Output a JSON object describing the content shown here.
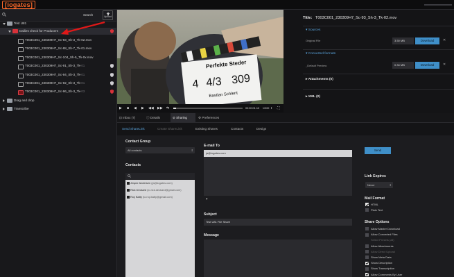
{
  "app": {
    "logo": "iogates"
  },
  "search": {
    "button_label": "Search",
    "upload_label": "Upload"
  },
  "tree": [
    {
      "label": "Test U81",
      "type": "folder",
      "suffix": ""
    },
    {
      "label": "Dailies check for Producers",
      "type": "folder-red",
      "suffix": ""
    },
    {
      "label": "T003C001_230309H7_Sc-93_Sh-3_Tk-02.mov",
      "type": "video",
      "suffix": ""
    },
    {
      "label": "T003C001_230309H7_Sc-88_Sh-7_Tk-01.mov",
      "type": "video",
      "suffix": ""
    },
    {
      "label": "T003C001_230309H7_Sc-104_Sh-5_Tk-0x.mov",
      "type": "video",
      "suffix": ""
    },
    {
      "label": "T003C001_230309H7_Sc-91_Sh-3_Tk-",
      "type": "video",
      "suffix": "01"
    },
    {
      "label": "T003C001_230309H7_Sc-94_Sh-3_Tk-",
      "type": "video",
      "suffix": "01"
    },
    {
      "label": "T003C001_230309H7_Sc-92_Sh-3_Tk-",
      "type": "video",
      "suffix": "01"
    },
    {
      "label": "T003C001_230309H7_Sc-96_Sh-3_Tk-",
      "type": "video-red",
      "suffix": "03"
    },
    {
      "label": "Drag and drop",
      "type": "folder",
      "suffix": ""
    },
    {
      "label": "Transcribe",
      "type": "folder",
      "suffix": ""
    }
  ],
  "player": {
    "time": "00:00:01:13",
    "duration": "1/200",
    "progress": 0.04,
    "clapper": {
      "title": "Perfekte Steder",
      "roll": "4",
      "scene": "4/3",
      "take": "309",
      "director": "Bastian Schlent"
    }
  },
  "info": {
    "title_label": "Title:",
    "title_value": "T003C001_230309H7_Sc-93_Sh-3_Tk-02.mov",
    "sources_label": "Sources",
    "original_label": "Original File",
    "original_size": "3.50 MB",
    "converted_label": "Converted formats",
    "preview_label": "_Default Preview",
    "preview_size": "0.34 MB",
    "download_label": "Download",
    "attachments_label": "Attachments (0)",
    "xml_label": "XML (0)"
  },
  "tabs": [
    {
      "label": "Inbox (7)",
      "icon": "inbox-icon"
    },
    {
      "label": "Details",
      "icon": "info-icon"
    },
    {
      "label": "Sharing",
      "icon": "link-icon"
    },
    {
      "label": "Preferences",
      "icon": "gear-icon"
    }
  ],
  "subtabs": [
    "Send ShareLink",
    "Create ShareLink",
    "Existing Shares",
    "Contacts",
    "Design"
  ],
  "sharing": {
    "contact_group_label": "Contact Group",
    "contact_group_value": "All contacts",
    "contacts_label": "Contacts",
    "contacts": [
      {
        "name": "Jesper Andersen",
        "email": "(ja@iogates.com)"
      },
      {
        "name": "Rick Deckard",
        "email": "(io.rick.deckard@gmail.com)"
      },
      {
        "name": "Roy Batty",
        "email": "(io.roy.batty@gmail.com)"
      }
    ],
    "email_to_label": "E-mail To",
    "email_to_value": "ja@iogates.com",
    "subject_label": "Subject",
    "subject_value": "Test U81 File Share",
    "message_label": "Message",
    "send_label": "Send",
    "link_expires_label": "Link Expires",
    "link_expires_value": "Never",
    "mail_format_label": "Mail Format",
    "mail_formats": [
      {
        "label": "HTML",
        "checked": true
      },
      {
        "label": "Plain Text",
        "checked": false
      }
    ],
    "share_options_label": "Share Options",
    "share_options": [
      {
        "label": "Allow Master Download",
        "checked": false,
        "dim": false
      },
      {
        "label": "Allow Converted Files",
        "checked": false,
        "dim": false
      },
      {
        "label": "Select Presets (all)",
        "checked": null,
        "dim": true
      },
      {
        "label": "Allow Attachments",
        "checked": false,
        "dim": false
      },
      {
        "label": "Allow Direct Upload",
        "checked": false,
        "dim": true
      },
      {
        "label": "Show Meta Data",
        "checked": false,
        "dim": false
      },
      {
        "label": "Show Description",
        "checked": true,
        "dim": false
      },
      {
        "label": "Show Transcription",
        "checked": false,
        "dim": false
      },
      {
        "label": "Allow Comments By User",
        "checked": true,
        "dim": false
      }
    ]
  },
  "colors": {
    "accent": "#3f8fc8",
    "brand": "#ff6a2a",
    "alert": "#d8323a"
  }
}
